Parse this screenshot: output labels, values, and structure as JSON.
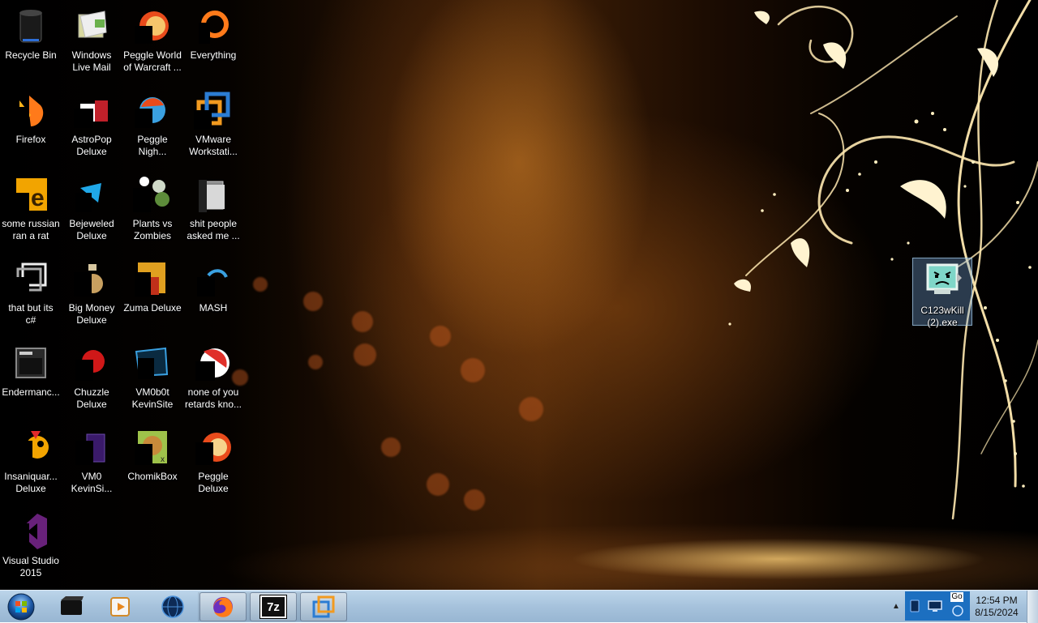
{
  "desktop": {
    "icons": [
      {
        "label": "Recycle Bin",
        "icon": "recycle-bin-icon"
      },
      {
        "label": "Windows\nLive Mail",
        "icon": "windows-live-mail-icon"
      },
      {
        "label": "Peggle World\nof Warcraft ...",
        "icon": "peggle-icon"
      },
      {
        "label": "Everything",
        "icon": "everything-search-icon"
      },
      {
        "label": "Firefox",
        "icon": "firefox-icon"
      },
      {
        "label": "AstroPop\nDeluxe",
        "icon": "astropop-icon"
      },
      {
        "label": "Peggle\nNigh...",
        "icon": "peggle-nights-icon"
      },
      {
        "label": "VMware\nWorkstati...",
        "icon": "vmware-icon"
      },
      {
        "label": "some russian\nran a rat",
        "icon": "text-file-icon"
      },
      {
        "label": "Bejeweled\nDeluxe",
        "icon": "bejeweled-icon"
      },
      {
        "label": "Plants vs\nZombies",
        "icon": "plants-vs-zombies-icon"
      },
      {
        "label": "shit people\nasked me ...",
        "icon": "folder-icon"
      },
      {
        "label": "that but its\nc#",
        "icon": "shortcut-icon"
      },
      {
        "label": "Big Money\nDeluxe",
        "icon": "big-money-icon"
      },
      {
        "label": "Zuma Deluxe",
        "icon": "zuma-icon"
      },
      {
        "label": "MASH",
        "icon": "mash-icon"
      },
      {
        "label": "Endermanc...",
        "icon": "endermanch-icon"
      },
      {
        "label": "Chuzzle\nDeluxe",
        "icon": "chuzzle-icon"
      },
      {
        "label": "VM0b0t\nKevinSite",
        "icon": "vm-folder-icon"
      },
      {
        "label": "none of you\nretards kno...",
        "icon": "app-icon"
      },
      {
        "label": "Insaniquar...\nDeluxe",
        "icon": "insaniquarium-icon"
      },
      {
        "label": "VM0\nKevinSi...",
        "icon": "vm-icon"
      },
      {
        "label": "ChomikBox",
        "icon": "chomikbox-icon"
      },
      {
        "label": "Peggle\nDeluxe",
        "icon": "peggle-deluxe-icon"
      },
      {
        "label": "Visual Studio\n2015",
        "icon": "visual-studio-icon"
      },
      {
        "label": "C123wKill\n(2).exe",
        "icon": "sad-computer-icon"
      }
    ]
  },
  "taskbar": {
    "buttons": [
      {
        "name": "media-icon",
        "state": "pinned"
      },
      {
        "name": "media-player-icon",
        "state": "pinned"
      },
      {
        "name": "globe-icon",
        "state": "pinned"
      },
      {
        "name": "firefox-icon",
        "state": "running"
      },
      {
        "name": "7zip-icon",
        "state": "running",
        "text": "7z"
      },
      {
        "name": "vmware-icon",
        "state": "running"
      }
    ],
    "tray": {
      "overflow_arrow": "▲",
      "google_label": "Go",
      "time": "12:54 PM",
      "date": "8/15/2024"
    }
  }
}
